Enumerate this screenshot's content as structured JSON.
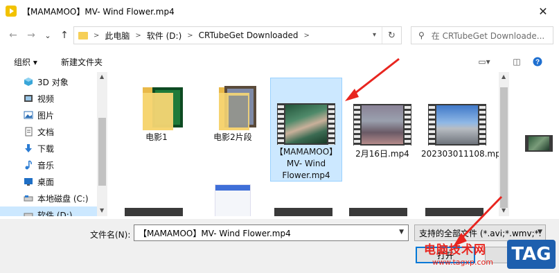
{
  "window": {
    "title": "【MAMAMOO】MV- Wind Flower.mp4",
    "close": "✕"
  },
  "nav": {
    "back": "←",
    "forward": "→",
    "recent": "⌄",
    "up": "↑",
    "crumbs": [
      "此电脑",
      "软件 (D:)",
      "CRTubeGet Downloaded"
    ],
    "refresh": "↻",
    "search_placeholder": "在 CRTubeGet Downloade..."
  },
  "toolbar": {
    "organize": "组织 ▾",
    "new_folder": "新建文件夹"
  },
  "sidebar": {
    "items": [
      {
        "label": "3D 对象",
        "icon": "3d-objects-icon"
      },
      {
        "label": "视频",
        "icon": "video-icon"
      },
      {
        "label": "图片",
        "icon": "pictures-icon"
      },
      {
        "label": "文档",
        "icon": "documents-icon"
      },
      {
        "label": "下载",
        "icon": "downloads-icon"
      },
      {
        "label": "音乐",
        "icon": "music-icon"
      },
      {
        "label": "桌面",
        "icon": "desktop-icon"
      },
      {
        "label": "本地磁盘 (C:)",
        "icon": "drive-icon"
      },
      {
        "label": "软件 (D:)",
        "icon": "drive-icon"
      }
    ]
  },
  "files": [
    {
      "name": "电影1",
      "kind": "folder"
    },
    {
      "name": "电影2片段",
      "kind": "folder"
    },
    {
      "name": "【MAMAMOO】MV- Wind Flower.mp4",
      "kind": "video",
      "selected": true
    },
    {
      "name": "2月16日.mp4",
      "kind": "video"
    },
    {
      "name": "202303011108.mp4",
      "kind": "video"
    }
  ],
  "bottom": {
    "filename_label": "文件名(N):",
    "filename_value": "【MAMAMOO】MV- Wind Flower.mp4",
    "filter_value": "支持的全部文件 (*.avi;*.wmv;*.",
    "open_label": "打开"
  },
  "watermark": {
    "text": "电脑技术网",
    "url": "www.tagxp.com",
    "tag": "TAG"
  },
  "colors": {
    "selection": "#cce8ff",
    "accent": "#0078d7",
    "annotation": "#e8251f"
  }
}
